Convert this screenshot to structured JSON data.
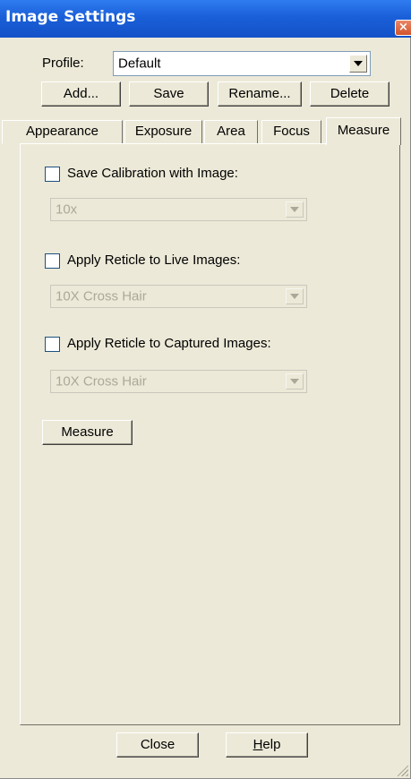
{
  "window": {
    "title": "Image Settings",
    "close_glyph": "×"
  },
  "profile": {
    "label": "Profile:",
    "value": "Default",
    "buttons": {
      "add": "Add...",
      "save": "Save",
      "rename": "Rename...",
      "delete": "Delete"
    }
  },
  "tabs": [
    {
      "label": "Appearance",
      "active": false
    },
    {
      "label": "Exposure",
      "active": false
    },
    {
      "label": "Area",
      "active": false
    },
    {
      "label": "Focus",
      "active": false
    },
    {
      "label": "Measure",
      "active": true
    }
  ],
  "measure": {
    "save_calibration": {
      "label": "Save Calibration with Image:",
      "checked": false,
      "select_value": "10x",
      "select_enabled": false
    },
    "reticle_live": {
      "label": "Apply Reticle to Live Images:",
      "checked": false,
      "select_value": "10X Cross Hair",
      "select_enabled": false
    },
    "reticle_captured": {
      "label": "Apply Reticle to Captured Images:",
      "checked": false,
      "select_value": "10X Cross Hair",
      "select_enabled": false
    },
    "measure_button": "Measure"
  },
  "footer": {
    "close": "Close",
    "help_mnemonic": "H",
    "help_rest": "elp"
  },
  "icons": {
    "close": "close-icon",
    "dropdown": "chevron-down-icon",
    "resize": "resize-grip-icon"
  },
  "colors": {
    "titlebar": "#1a5fd8",
    "window_bg": "#ECE9D8",
    "close_button": "#d2542c",
    "disabled_text": "#aca899"
  }
}
